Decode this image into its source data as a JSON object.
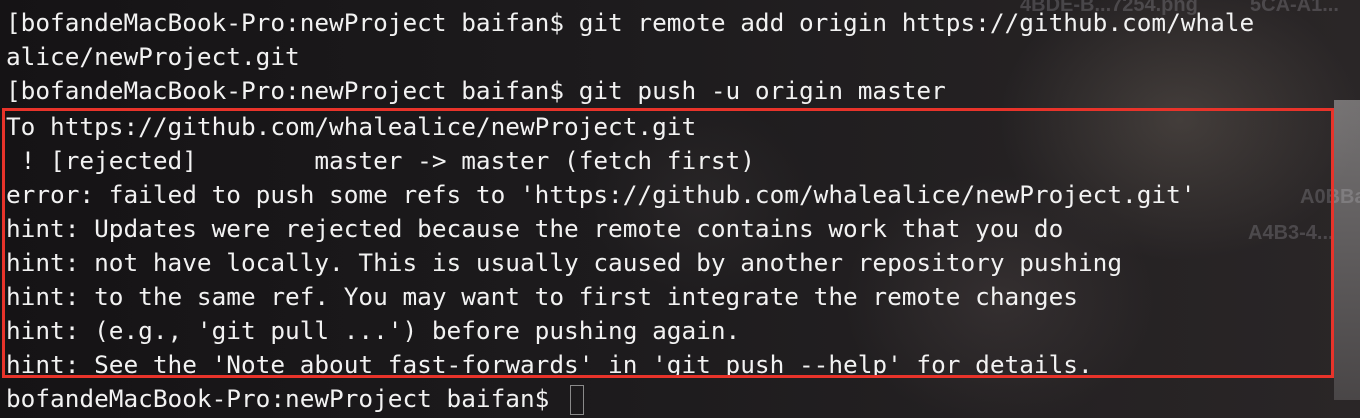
{
  "desktop_labels": [
    "4BDE-B...7254.png",
    "5CA-A1...",
    "A0BBa...",
    "A4B3-4..."
  ],
  "terminal": {
    "lines": [
      "[bofandeMacBook-Pro:newProject baifan$ git remote add origin https://github.com/whale",
      "alice/newProject.git",
      "[bofandeMacBook-Pro:newProject baifan$ git push -u origin master",
      "To https://github.com/whalealice/newProject.git",
      " ! [rejected]        master -> master (fetch first)",
      "error: failed to push some refs to 'https://github.com/whalealice/newProject.git'",
      "hint: Updates were rejected because the remote contains work that you do",
      "hint: not have locally. This is usually caused by another repository pushing",
      "hint: to the same ref. You may want to first integrate the remote changes",
      "hint: (e.g., 'git pull ...') before pushing again.",
      "hint: See the 'Note about fast-forwards' in 'git push --help' for details.",
      "bofandeMacBook-Pro:newProject baifan$ "
    ]
  },
  "colors": {
    "text": "#f2f2f2",
    "background": "#1c1a1c",
    "highlight_border": "#e8332a"
  }
}
